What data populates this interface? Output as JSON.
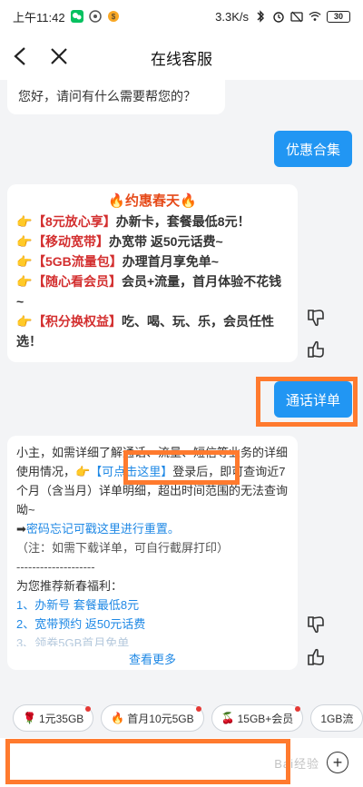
{
  "status": {
    "time": "上午11:42",
    "speed": "3.3K/s",
    "battery": "30"
  },
  "nav": {
    "title": "在线客服"
  },
  "chat": {
    "greeting": "您好，请问有什么需要帮您的？",
    "btn_offers": "优惠合集",
    "promo": {
      "title": "🔥约惠春天🔥",
      "items": [
        {
          "tag": "【8元放心享】",
          "text": "办新卡，套餐最低8元！"
        },
        {
          "tag": "【移动宽带】",
          "text": "办宽带 返50元话费~"
        },
        {
          "tag": "【5GB流量包】",
          "text": "办理首月享免单~"
        },
        {
          "tag": "【随心看会员】",
          "text": "会员+流量，首月体验不花钱~"
        },
        {
          "tag": "【积分换权益】",
          "text": "吃、喝、玩、乐，会员任性选！"
        }
      ]
    },
    "btn_call_detail": "通话详单",
    "detail": {
      "p1a": "小主，如需详细了解通话、流量、短信等业务的详细使用情况，",
      "link": "【可点击这里】",
      "p1b": "登录后，即可查询近7个月（含当月）详单明细，超出时间范围的无法查询呦~",
      "arrow": "➡",
      "reset": "密码忘记可戳这里进行重置。",
      "note": "（注：如需下载详单，可自行截屏打印）",
      "sep": "--------------------",
      "rec": "为您推荐新春福利：",
      "list": [
        "1、办新号 套餐最低8元",
        "2、宽带预约 返50元话费",
        "3、领券5GB首月免单"
      ],
      "more": "查看更多"
    }
  },
  "quick": {
    "chips": [
      {
        "emo": "🌹",
        "label": "1元35GB"
      },
      {
        "emo": "🔥",
        "label": "首月10元5GB"
      },
      {
        "emo": "🍒",
        "label": "15GB+会员"
      },
      {
        "emo": "",
        "label": "1GB流"
      }
    ]
  },
  "input": {
    "placeholder": ""
  },
  "watermark": "Bai经验"
}
